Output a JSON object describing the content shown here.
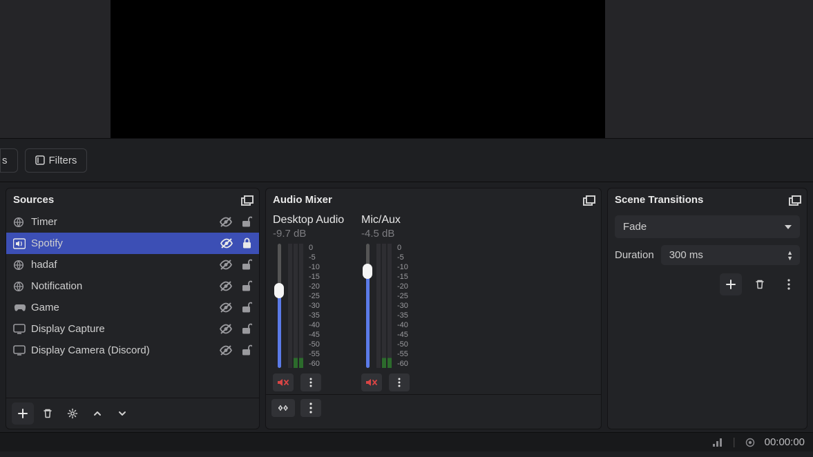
{
  "toolbar": {
    "partial_label": "s",
    "filters_label": "Filters"
  },
  "sources": {
    "title": "Sources",
    "items": [
      {
        "icon": "globe",
        "label": "Timer",
        "selected": false,
        "locked": false
      },
      {
        "icon": "speaker",
        "label": "Spotify",
        "selected": true,
        "locked": true
      },
      {
        "icon": "globe",
        "label": "hadaf",
        "selected": false,
        "locked": false
      },
      {
        "icon": "globe",
        "label": "Notification",
        "selected": false,
        "locked": false
      },
      {
        "icon": "gamepad",
        "label": "Game",
        "selected": false,
        "locked": false
      },
      {
        "icon": "display",
        "label": "Display Capture",
        "selected": false,
        "locked": false
      },
      {
        "icon": "display",
        "label": "Display Camera (Discord)",
        "selected": false,
        "locked": false
      }
    ]
  },
  "mixer": {
    "title": "Audio Mixer",
    "channels": [
      {
        "name": "Desktop Audio",
        "db": "-9.7 dB",
        "fill_pct": 62,
        "thumb_pct": 62
      },
      {
        "name": "Mic/Aux",
        "db": "-4.5 dB",
        "fill_pct": 78,
        "thumb_pct": 78
      }
    ],
    "scale": [
      "0",
      "-5",
      "-10",
      "-15",
      "-20",
      "-25",
      "-30",
      "-35",
      "-40",
      "-45",
      "-50",
      "-55",
      "-60"
    ]
  },
  "transitions": {
    "title": "Scene Transitions",
    "selected": "Fade",
    "duration_label": "Duration",
    "duration_value": "300 ms"
  },
  "status": {
    "time": "00:00:00"
  }
}
